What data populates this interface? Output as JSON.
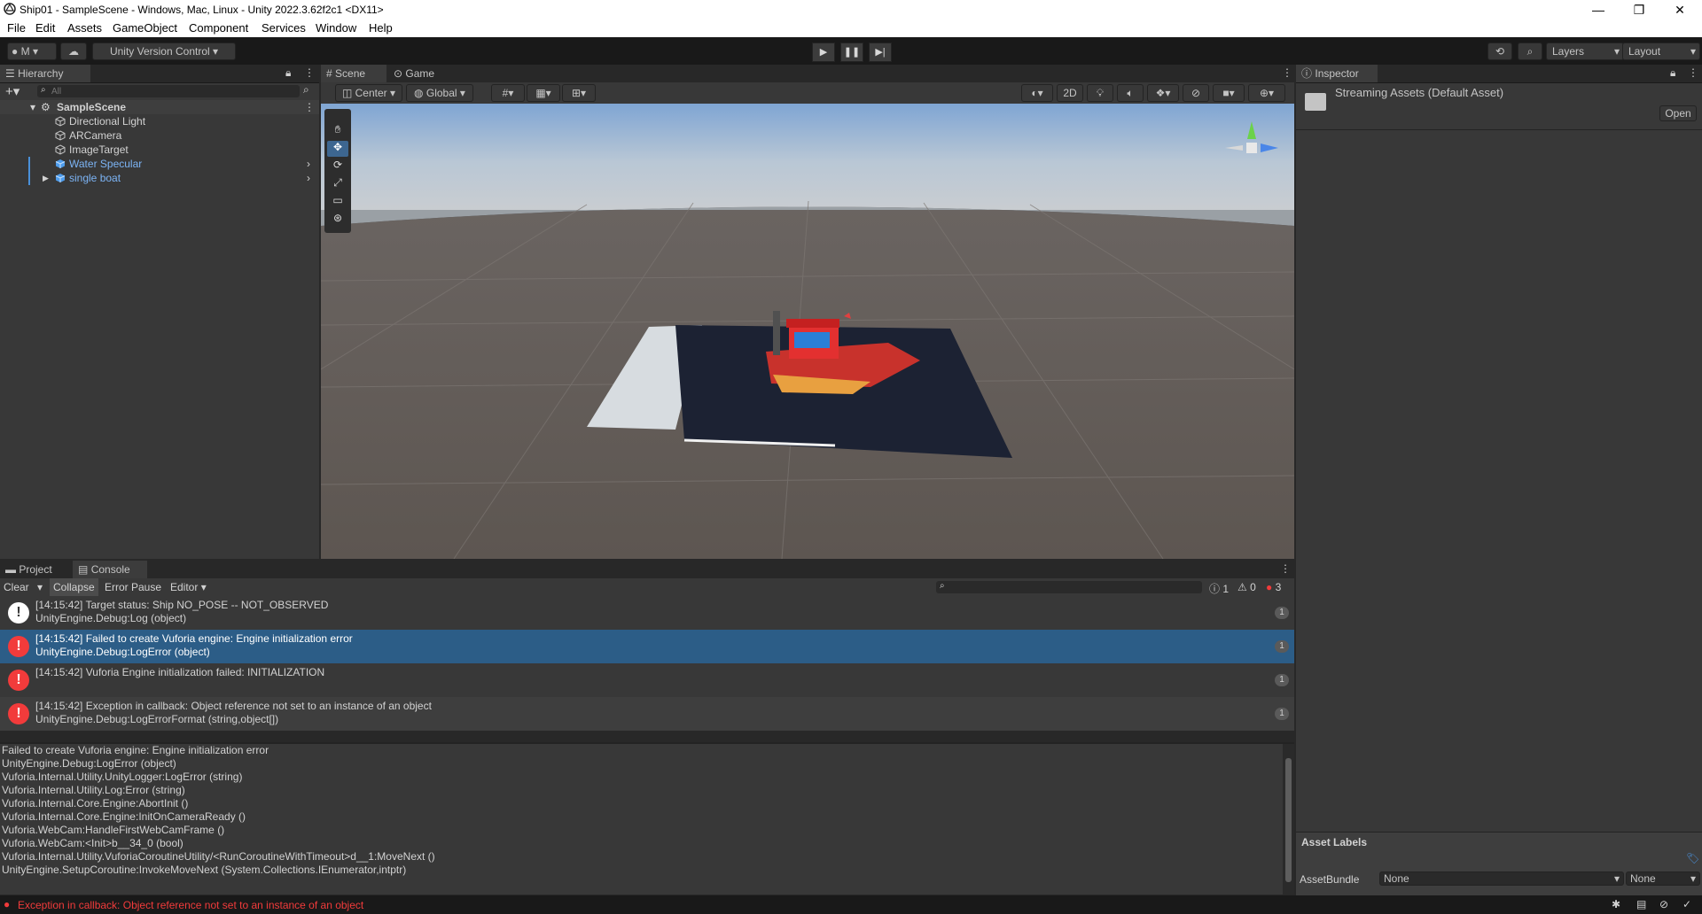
{
  "window": {
    "title": "Ship01 - SampleScene - Windows, Mac, Linux - Unity 2022.3.62f2c1 <DX11>",
    "minimize": "—",
    "maximize": "❐",
    "close": "✕"
  },
  "menu": [
    "File",
    "Edit",
    "Assets",
    "GameObject",
    "Component",
    "Services",
    "Window",
    "Help"
  ],
  "toolbar": {
    "account_label": "M",
    "version_control": "Unity Version Control",
    "layers": "Layers",
    "layout": "Layout"
  },
  "hierarchy": {
    "tab": "Hierarchy",
    "search_placeholder": "All",
    "scene": "SampleScene",
    "items": [
      {
        "label": "Directional Light",
        "prefab": false
      },
      {
        "label": "ARCamera",
        "prefab": false
      },
      {
        "label": "ImageTarget",
        "prefab": false
      },
      {
        "label": "Water Specular",
        "prefab": true
      },
      {
        "label": "single boat",
        "prefab": true
      }
    ]
  },
  "scene": {
    "tabs": [
      "Scene",
      "Game"
    ],
    "pivot": "Center",
    "space": "Global",
    "mode_2d": "2D"
  },
  "inspector": {
    "tab": "Inspector",
    "asset_title": "Streaming Assets (Default Asset)",
    "open_button": "Open",
    "asset_labels": "Asset Labels",
    "assetbundle_label": "AssetBundle",
    "assetbundle_value": "None",
    "assetbundle_variant": "None"
  },
  "console": {
    "tabs": [
      "Project",
      "Console"
    ],
    "clear": "Clear",
    "collapse": "Collapse",
    "error_pause": "Error Pause",
    "editor": "Editor",
    "counts": {
      "info": "1",
      "warning": "0",
      "error": "3"
    },
    "entries": [
      {
        "type": "info",
        "line1": "[14:15:42] Target status: Ship NO_POSE -- NOT_OBSERVED",
        "line2": "UnityEngine.Debug:Log (object)",
        "count": "1"
      },
      {
        "type": "error",
        "line1": "[14:15:42] Failed to create Vuforia engine: Engine initialization error",
        "line2": "UnityEngine.Debug:LogError (object)",
        "count": "1",
        "selected": true
      },
      {
        "type": "error",
        "line1": "[14:15:42] Vuforia Engine initialization failed: INITIALIZATION",
        "line2": "",
        "count": "1"
      },
      {
        "type": "error",
        "line1": "[14:15:42] Exception in callback: Object reference not set to an instance of an object",
        "line2": "UnityEngine.Debug:LogErrorFormat (string,object[])",
        "count": "1"
      }
    ],
    "details": [
      "Failed to create Vuforia engine: Engine initialization error",
      "UnityEngine.Debug:LogError (object)",
      "Vuforia.Internal.Utility.UnityLogger:LogError (string)",
      "Vuforia.Internal.Utility.Log:Error (string)",
      "Vuforia.Internal.Core.Engine:AbortInit ()",
      "Vuforia.Internal.Core.Engine:InitOnCameraReady ()",
      "Vuforia.WebCam:HandleFirstWebCamFrame ()",
      "Vuforia.WebCam:<Init>b__34_0 (bool)",
      "Vuforia.Internal.Utility.VuforiaCoroutineUtility/<RunCoroutineWithTimeout>d__1:MoveNext ()",
      "UnityEngine.SetupCoroutine:InvokeMoveNext (System.Collections.IEnumerator,intptr)"
    ]
  },
  "status": {
    "message": "Exception in callback: Object reference not set to an instance of an object"
  },
  "colors": {
    "accent": "#2c5d87",
    "error": "#f23b3b",
    "prefab": "#7cb4f5"
  }
}
